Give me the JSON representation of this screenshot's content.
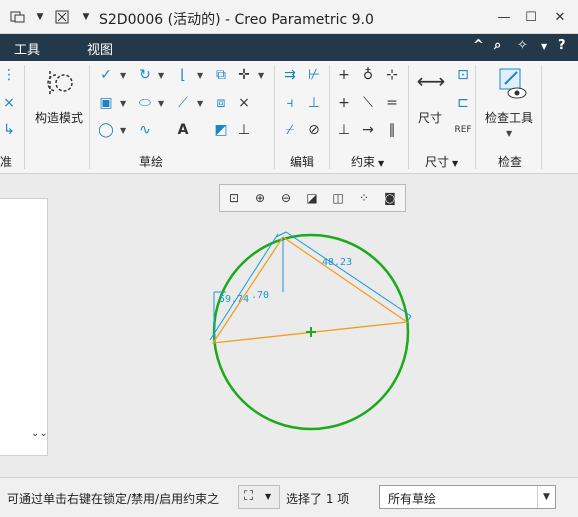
{
  "titlebar": {
    "title": "S2D0006 (活动的) - Creo Parametric 9.0",
    "minimize": "—",
    "maximize": "☐",
    "close": "✕"
  },
  "menubar": {
    "items": [
      "工具",
      "视图"
    ],
    "right_icons": [
      "^",
      "⌕",
      "✧",
      "?"
    ]
  },
  "ribbon": {
    "groups": {
      "left_cut": "准",
      "construction_mode": "构造模式",
      "sketch": "草绘",
      "edit": "编辑",
      "constraints": "约束",
      "dimension": "尺寸",
      "dimension_big": "尺寸",
      "inspect": "检查",
      "inspect_tools": "检查工具"
    },
    "text_icon": "A"
  },
  "sketch": {
    "dim_top": "48.23",
    "dim_left": "59.74",
    "dim_angle": ".70",
    "colors": {
      "circle": "#1aaa1a",
      "triangle": "#f0a020",
      "dimension": "#1a9ad6",
      "center": "#1aaa1a"
    }
  },
  "statusbar": {
    "message": "可通过单击右键在锁定/禁用/启用约束之",
    "selection": "选择了 1 项",
    "filter_value": "所有草绘"
  }
}
